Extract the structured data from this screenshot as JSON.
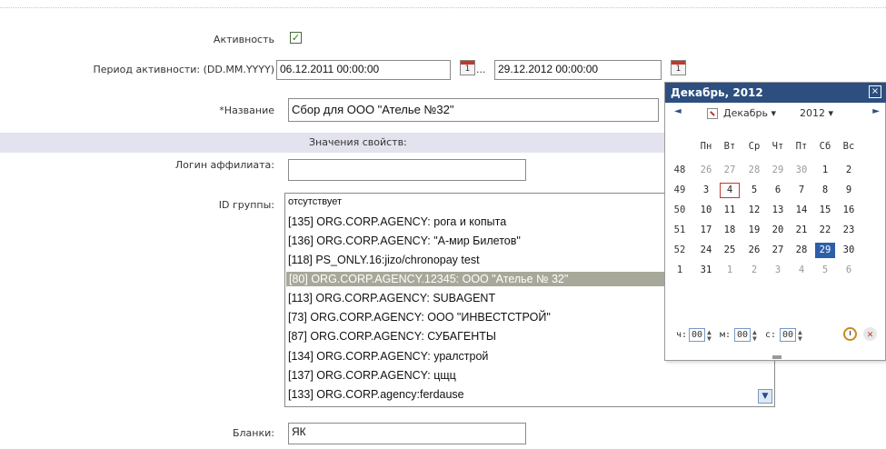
{
  "form": {
    "activity_label": "Активность",
    "activity_checked": true,
    "period_label": "Период активности: (DD.MM.YYYY)",
    "date_from": "06.12.2011 00:00:00",
    "date_sep": "...",
    "date_to": "29.12.2012 00:00:00",
    "calendar_icon_day": "1",
    "name_label": "*Название",
    "name_value": "Сбор для ООО \"Ателье №32\"",
    "section_title": "Значения свойств:",
    "affiliate_login_label": "Логин аффилиата:",
    "affiliate_login_value": "",
    "group_id_label": "ID группы:",
    "group_options": [
      "отсутствует",
      "[135] ORG.CORP.AGENCY: рога и копыта",
      "[136] ORG.CORP.AGENCY: \"А-мир Билетов\"",
      "[118] PS_ONLY.16:jizo/chronopay test",
      "[80] ORG.CORP.AGENCY.12345: ООО \"Ателье № 32\"",
      "[113] ORG.CORP.AGENCY: SUBAGENT",
      "[73] ORG.CORP.AGENCY: ООО \"ИНВЕСТСТРОЙ\"",
      "[87] ORG.CORP.AGENCY: СУБАГЕНТЫ",
      "[134] ORG.CORP.AGENCY: уралстрой",
      "[137] ORG.CORP.AGENCY: цщц",
      "[133] ORG.CORP.agency:ferdause"
    ],
    "group_selected_index": 4,
    "blanks_label": "Бланки:",
    "blanks_value": "ЯК"
  },
  "calendar": {
    "title": "Декабрь, 2012",
    "close_glyph": "×",
    "prev_glyph": "◄",
    "next_glyph": "►",
    "month_select": "Декабрь ▾",
    "year_select": "2012 ▾",
    "weekdays": [
      "Пн",
      "Вт",
      "Ср",
      "Чт",
      "Пт",
      "Сб",
      "Вс"
    ],
    "weeks": [
      {
        "num": "48",
        "days": [
          "26",
          "27",
          "28",
          "29",
          "30",
          "1",
          "2"
        ]
      },
      {
        "num": "49",
        "days": [
          "3",
          "4",
          "5",
          "6",
          "7",
          "8",
          "9"
        ]
      },
      {
        "num": "50",
        "days": [
          "10",
          "11",
          "12",
          "13",
          "14",
          "15",
          "16"
        ]
      },
      {
        "num": "51",
        "days": [
          "17",
          "18",
          "19",
          "20",
          "21",
          "22",
          "23"
        ]
      },
      {
        "num": "52",
        "days": [
          "24",
          "25",
          "26",
          "27",
          "28",
          "29",
          "30"
        ]
      },
      {
        "num": "1",
        "days": [
          "31",
          "1",
          "2",
          "3",
          "4",
          "5",
          "6"
        ]
      }
    ],
    "time_hour_label": "ч:",
    "time_hour": "00",
    "time_min_label": "м:",
    "time_min": "00",
    "time_sec_label": "с:",
    "time_sec": "00",
    "accent": "#2c4f7f",
    "selected_color": "#2c5fa8"
  }
}
